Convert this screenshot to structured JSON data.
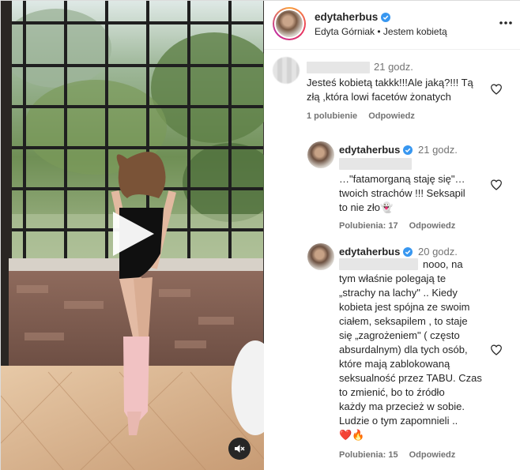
{
  "post": {
    "author": "edytaherbus",
    "author_subline": "Edyta Górniak • Jestem kobietą",
    "verified": true
  },
  "colors": {
    "verified": "#3897f0",
    "muted": "#737373",
    "text": "#262626"
  },
  "icons": {
    "play": "play-icon",
    "mute": "speaker-muted-icon",
    "more": "more-options-icon",
    "like": "heart-outline-icon",
    "verified": "verified-badge-icon"
  },
  "comments": [
    {
      "username": "",
      "time": "21 godz.",
      "lines": [
        "Jesteś kobietą takkk!!!Ale jaką?!!! Tą",
        "złą ,która lowi facetów żonatych"
      ],
      "likes_label": "1 polubienie",
      "reply_label": "Odpowiedz"
    },
    {
      "username": "edytaherbus",
      "time": "21 godz.",
      "lines": [
        "…\"fatamorganą staję się\"…",
        "twoich strachów !!! Seksapil",
        "to nie zło👻"
      ],
      "likes_label": "Polubienia: 17",
      "reply_label": "Odpowiedz"
    },
    {
      "username": "edytaherbus",
      "time": "20 godz.",
      "lines": [
        "nooo, na",
        "tym właśnie polegają te",
        "„strachy na lachy\" .. Kiedy",
        "kobieta jest spójna ze swoim",
        "ciałem, seksapilem , to staje",
        "się „zagrożeniem\" ( często",
        "absurdalnym) dla tych osób,",
        "które mają zablokowaną",
        "seksualność przez TABU. Czas",
        "to zmienić, bo to źródło",
        "każdy ma przecież w sobie.",
        "Ludzie o tym zapomnieli ..",
        "❤️🔥"
      ],
      "likes_label": "Polubienia: 15",
      "reply_label": "Odpowiedz"
    }
  ]
}
